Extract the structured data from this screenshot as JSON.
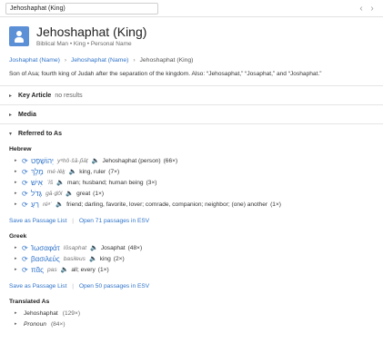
{
  "search": {
    "value": "Jehoshaphat (King)"
  },
  "nav": {
    "back": "‹",
    "forward": "›"
  },
  "header": {
    "title": "Jehoshaphat (King)",
    "subtitle": "Biblical Man • King • Personal Name"
  },
  "breadcrumb": {
    "items": [
      "Joshaphat (Name)",
      "Jehoshaphat (Name)",
      "Jehoshaphat (King)"
    ],
    "sep": "›"
  },
  "description": "Son of Asa; fourth king of Judah after the separation of the kingdom. Also: “Jehosaphat,” “Josaphat,” and “Joshaphat.”",
  "key_article": {
    "label": "Key Article",
    "note": "no results"
  },
  "media": {
    "label": "Media"
  },
  "referred": {
    "label": "Referred to As",
    "hebrew": {
      "label": "Hebrew",
      "items": [
        {
          "orig": "יְהוֹשָׁפָט",
          "translit": "yᵉhô·šā·p̄āṭ",
          "gloss": "Jehoshaphat (person)",
          "count": "(66×)"
        },
        {
          "orig": "מֶלֶךְ",
          "translit": "mé·lěḵ",
          "gloss": "king, ruler",
          "count": "(7×)"
        },
        {
          "orig": "אִישׁ",
          "translit": "ʾîš",
          "gloss": "man; husband; human being",
          "count": "(3×)"
        },
        {
          "orig": "גָּדֹל",
          "translit": "gā·ḏôl",
          "gloss": "great",
          "count": "(1×)"
        },
        {
          "orig": "רֵעַ",
          "translit": "réᵃʿ",
          "gloss": "friend; darling, favorite, lover; comrade, companion; neighbor; (one) another",
          "count": "(1×)"
        }
      ],
      "save_label": "Save as Passage List",
      "open_label": "Open 71 passages in ESV"
    },
    "greek": {
      "label": "Greek",
      "items": [
        {
          "orig": "Ἰωσαφάτ",
          "translit": "Iōsaphat",
          "gloss": "Josaphat",
          "count": "(48×)"
        },
        {
          "orig": "βασιλεύς",
          "translit": "basileus",
          "gloss": "king",
          "count": "(2×)"
        },
        {
          "orig": "πᾶς",
          "translit": "pas",
          "gloss": "all; every",
          "count": "(1×)"
        }
      ],
      "save_label": "Save as Passage List",
      "open_label": "Open 50 passages in ESV"
    }
  },
  "translated": {
    "label": "Translated As",
    "items": [
      {
        "term": "Jehoshaphat",
        "count": "(129×)"
      },
      {
        "term": "Pronoun",
        "count": "(84×)"
      }
    ]
  },
  "icons": {
    "expand": "▸",
    "collapse": "▾",
    "refresh": "⟳",
    "speaker": "🔈"
  },
  "colors": {
    "link": "#2f73c9",
    "person_icon": "#5b8fd6"
  }
}
